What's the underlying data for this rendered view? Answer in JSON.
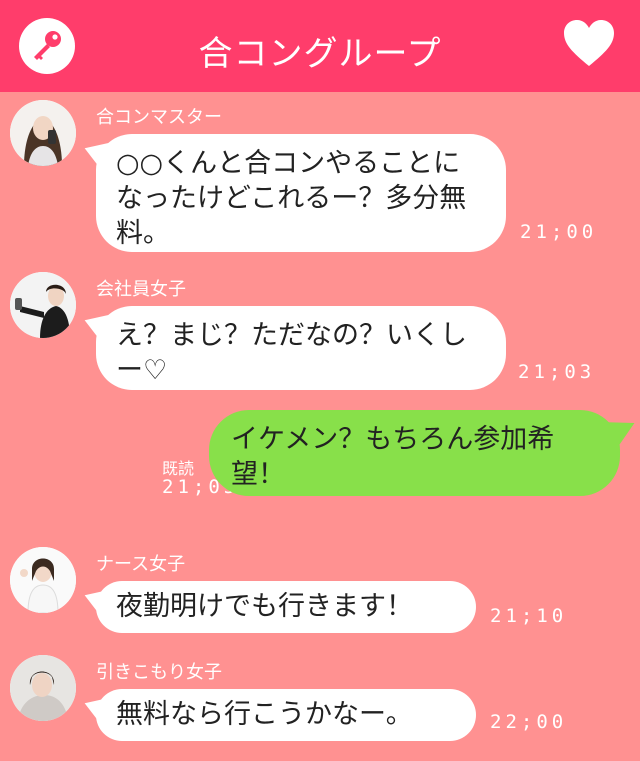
{
  "header": {
    "title": "合コングループ",
    "key_icon": "key-icon",
    "heart_icon": "heart-icon"
  },
  "messages": [
    {
      "sender": "合コンマスター",
      "text": "○○くんと合コンやることになったけどこれるー？多分無料。",
      "time": "21;00"
    },
    {
      "sender": "会社員女子",
      "text": "え？まじ？ただなの？いくしー♡",
      "time": "21;03"
    },
    {
      "sender": "ナース女子",
      "text": "夜勤明けでも行きます！",
      "time": "21;10"
    },
    {
      "sender": "引きこもり女子",
      "text": "無料なら行こうかなー。",
      "time": "22;00"
    }
  ],
  "own_message": {
    "text": "イケメン？もちろん参加希望！",
    "read_label": "既読",
    "time": "21;05"
  },
  "colors": {
    "header": "#ff3d6b",
    "background": "#ff9191",
    "own_bubble": "#88e04a",
    "other_bubble": "#ffffff"
  }
}
